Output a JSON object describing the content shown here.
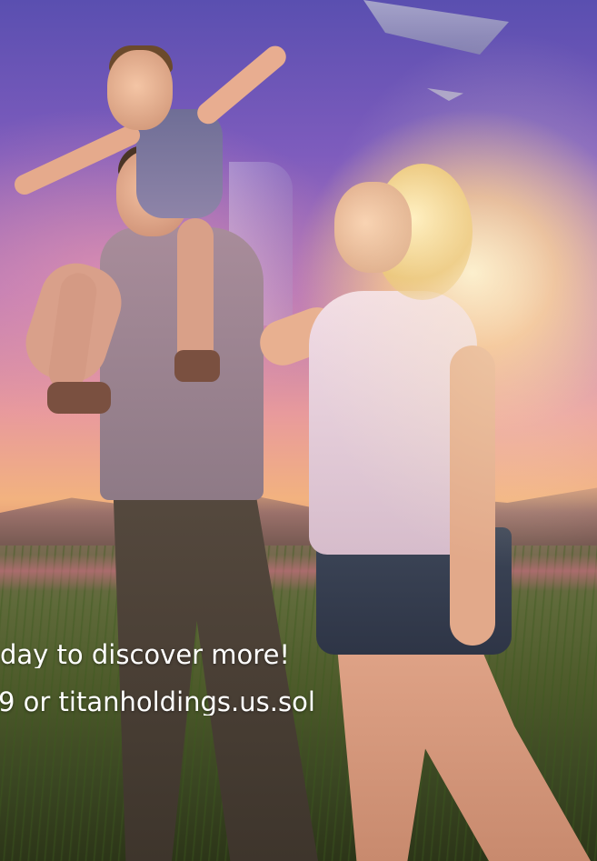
{
  "caption": {
    "line1": "day to discover more!",
    "line2": "9 or titanholdings.us.sol"
  },
  "colors": {
    "text": "#ffffff",
    "sky_top": "#5a4fb0",
    "sun_glow": "#fff6d2",
    "field": "#4d5a2a"
  }
}
